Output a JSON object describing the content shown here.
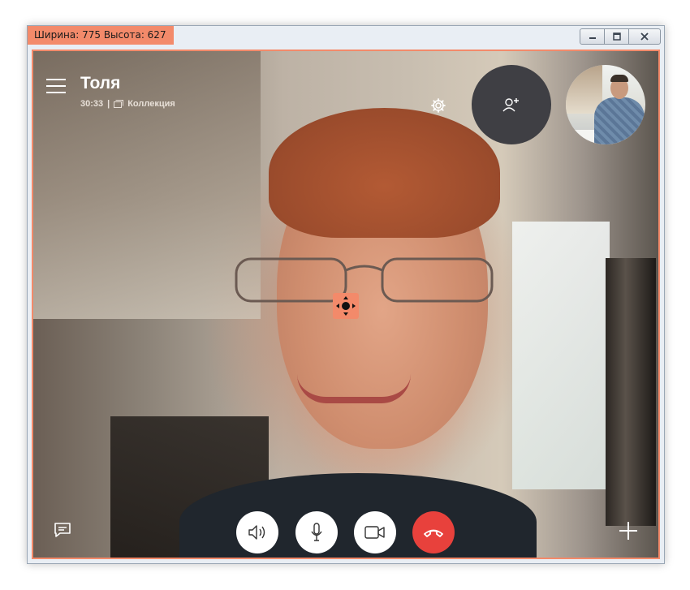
{
  "window": {
    "size_badge": "Ширина: 775  Высота: 627",
    "controls": [
      "minimize-icon",
      "maximize-icon",
      "close-icon"
    ]
  },
  "call": {
    "contact_name": "Толя",
    "duration": "30:33",
    "separator": "|",
    "collection_label": "Коллекция"
  },
  "icons": {
    "menu": "hamburger-icon",
    "settings": "gear-icon",
    "add_people": "add-person-icon",
    "move": "move-icon",
    "chat": "chat-icon",
    "speaker": "speaker-icon",
    "mic": "microphone-icon",
    "video": "video-camera-icon",
    "hangup": "hang-up-icon",
    "more": "plus-icon"
  },
  "colors": {
    "accent": "#f38a6a",
    "hangup": "#e8413c",
    "add_people_bg": "#3f3f44"
  }
}
